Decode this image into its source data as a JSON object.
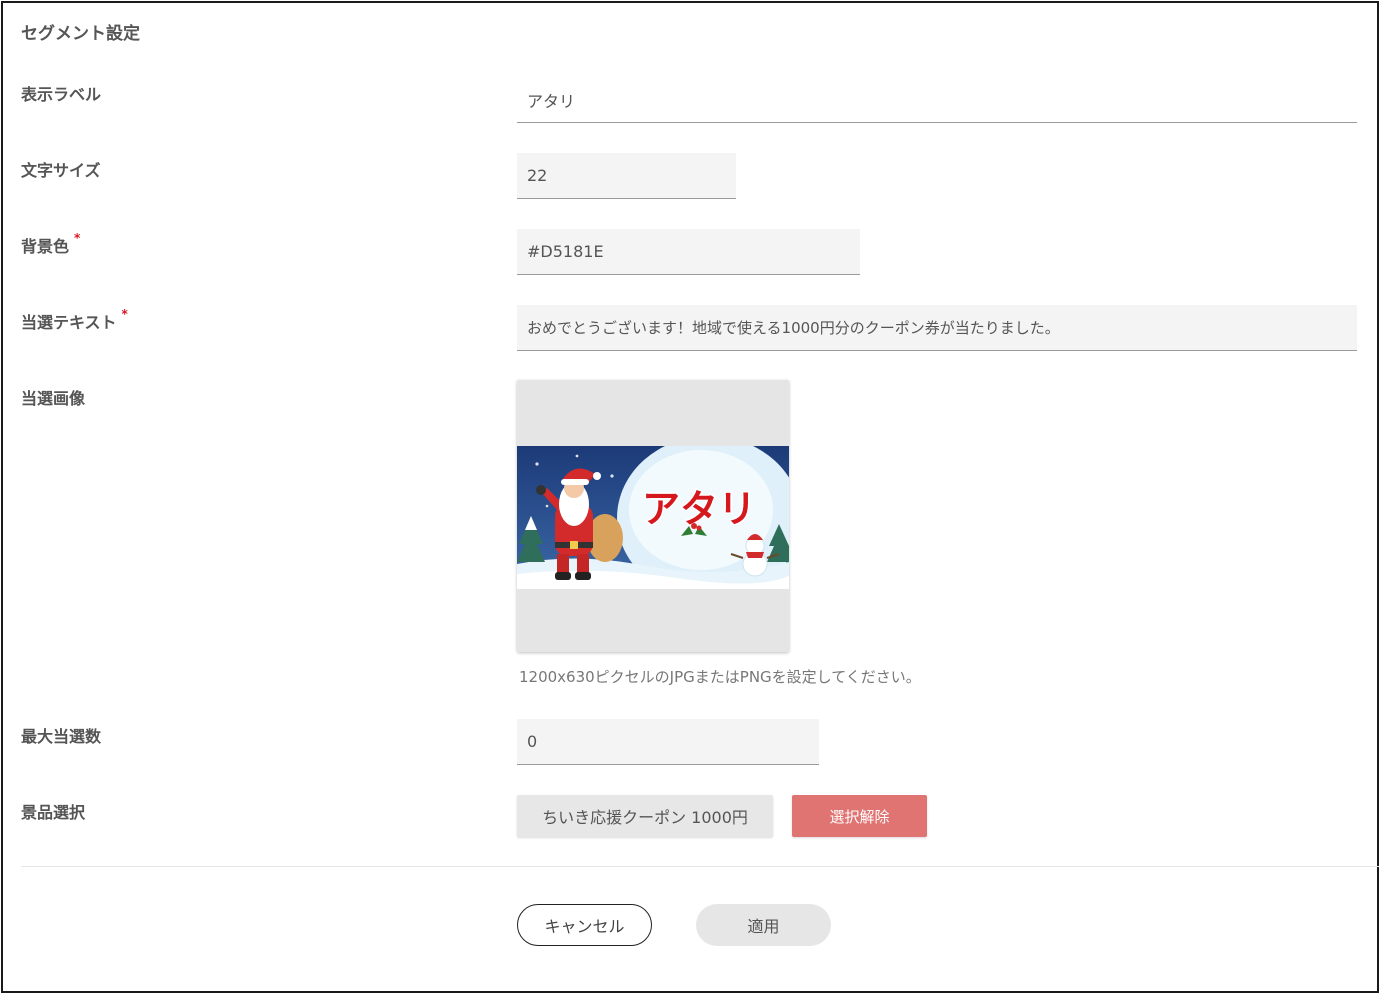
{
  "dialog": {
    "title": "セグメント設定"
  },
  "fields": {
    "label": {
      "name": "表示ラベル",
      "value": "アタリ"
    },
    "font_size": {
      "name": "文字サイズ",
      "value": "22"
    },
    "bg_color": {
      "name": "背景色",
      "required": "*",
      "value": "#D5181E"
    },
    "win_text": {
      "name": "当選テキスト",
      "required": "*",
      "value": "おめでとうございます！地域で使える1000円分のクーポン券が当たりました。"
    },
    "win_image": {
      "name": "当選画像",
      "hint": "1200x630ピクセルのJPGまたはPNGを設定してください。",
      "image_text": "アタリ"
    },
    "max_winners": {
      "name": "最大当選数",
      "value": "0"
    },
    "prize": {
      "name": "景品選択",
      "selected": "ちいき応援クーポン 1000円",
      "clear_label": "選択解除"
    }
  },
  "footer": {
    "cancel_label": "キャンセル",
    "apply_label": "適用"
  },
  "colors": {
    "accent": "#D5181E",
    "clear_button": "#E07472",
    "field_bg": "#F4F4F4"
  }
}
